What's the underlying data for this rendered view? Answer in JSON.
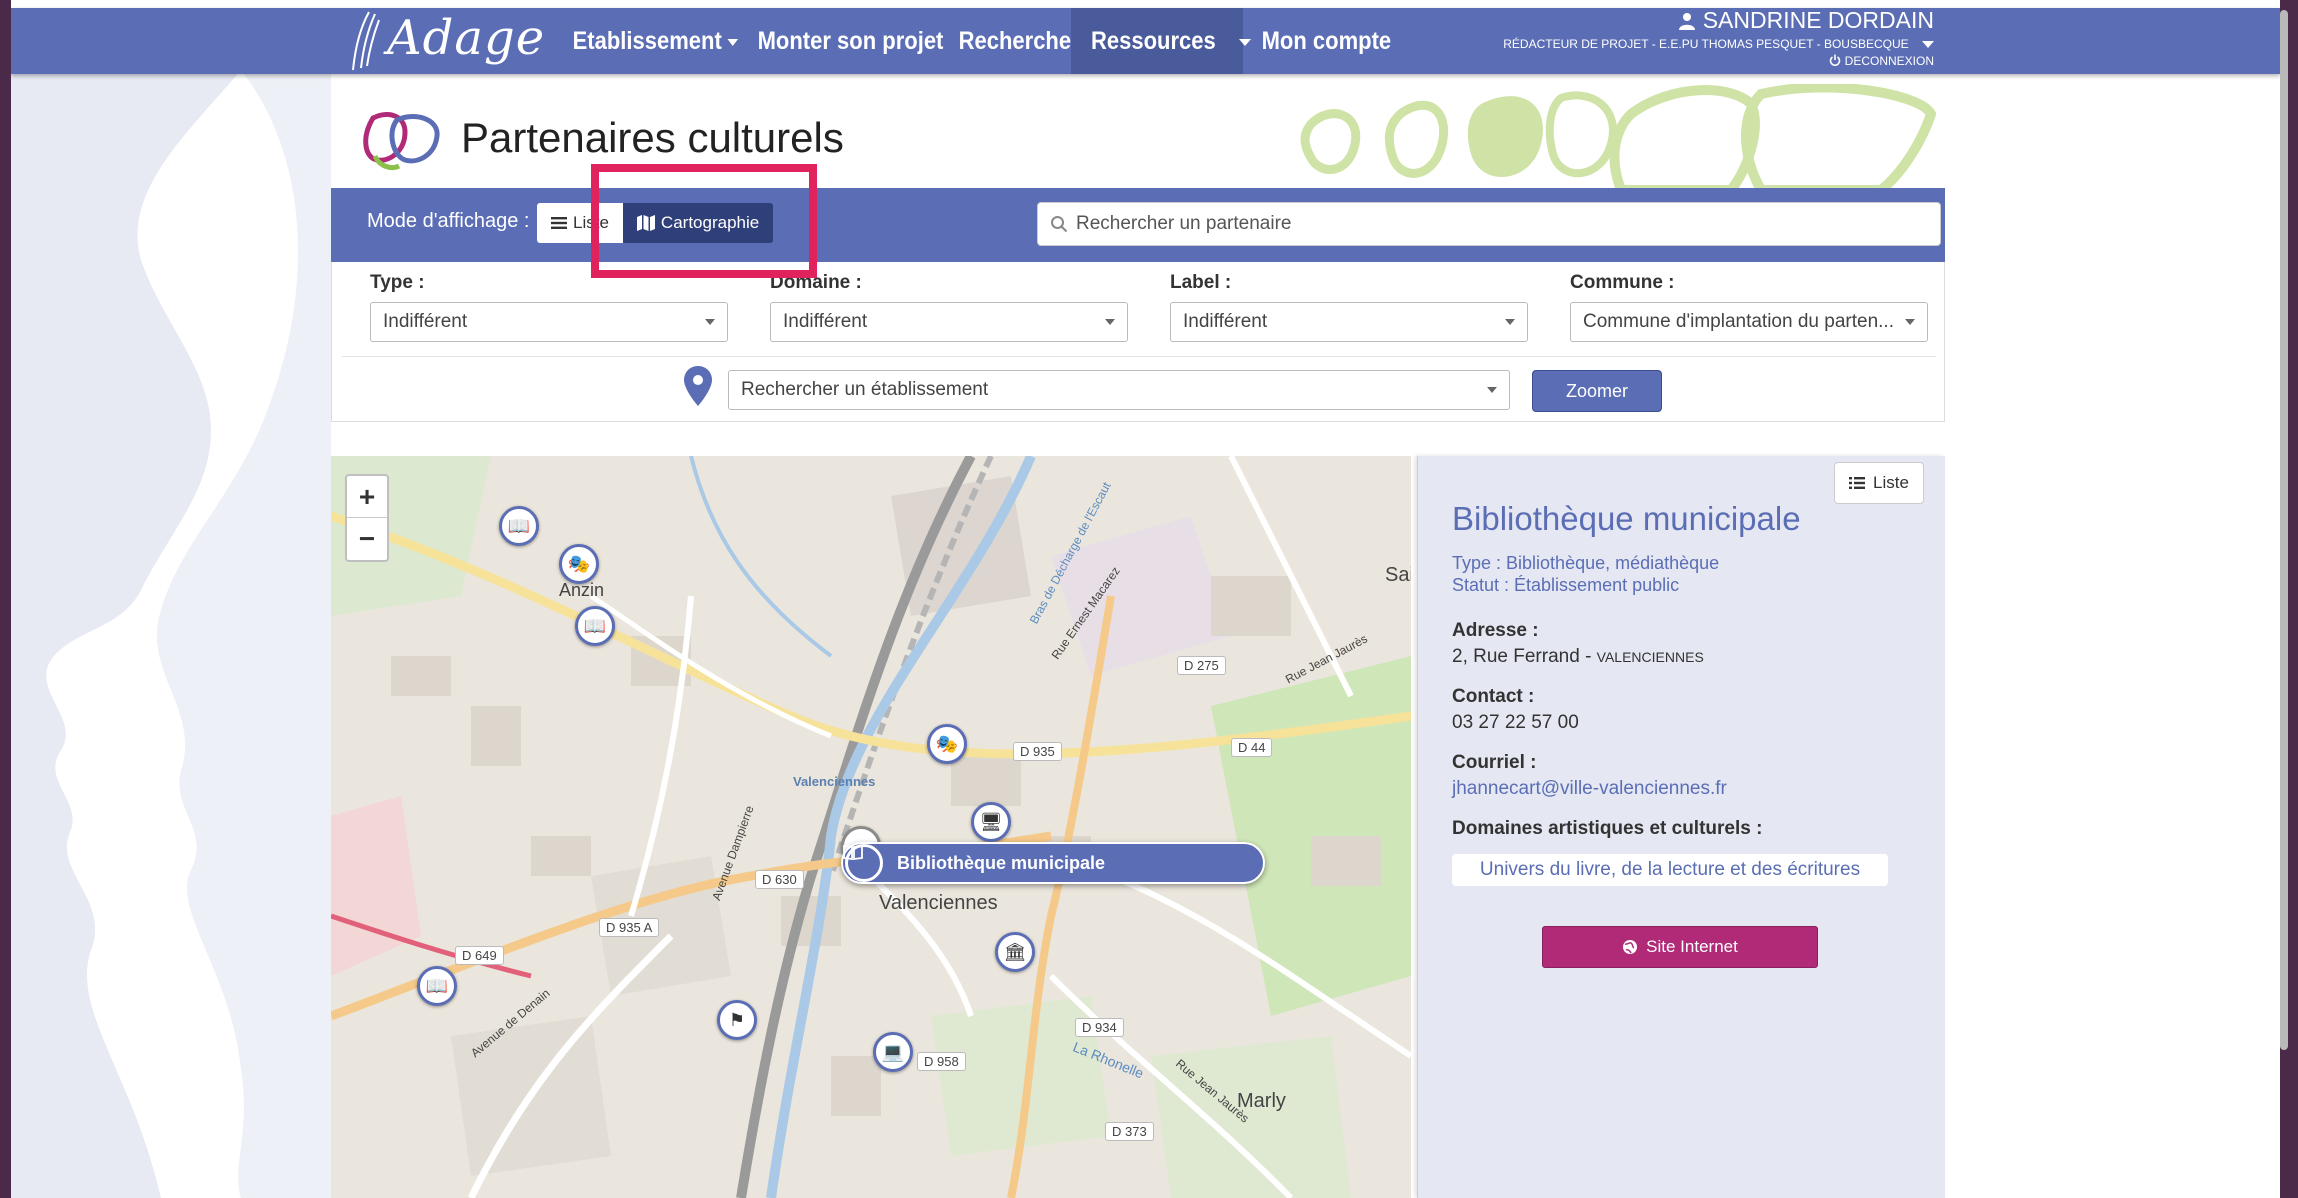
{
  "nav": {
    "logo": "Adage",
    "items": [
      {
        "label": "Etablissement",
        "has_caret": true
      },
      {
        "label": "Monter son projet",
        "has_caret": false
      },
      {
        "label": "Rechercher",
        "has_caret": false
      },
      {
        "label": "Ressources",
        "has_caret": true
      },
      {
        "label": "Mon compte",
        "has_caret": false
      }
    ],
    "user_name": "SANDRINE DORDAIN",
    "user_role": "RÉDACTEUR DE PROJET - E.E.PU THOMAS PESQUET - BOUSBECQUE",
    "logout": "DECONNEXION"
  },
  "page": {
    "title": "Partenaires culturels"
  },
  "display_mode": {
    "label": "Mode d'affichage :",
    "list_label": "Liste",
    "map_label": "Cartographie",
    "selected": "Cartographie"
  },
  "search": {
    "placeholder": "Rechercher un partenaire"
  },
  "filters": [
    {
      "label": "Type :",
      "value": "Indifférent"
    },
    {
      "label": "Domaine :",
      "value": "Indifférent"
    },
    {
      "label": "Label :",
      "value": "Indifférent"
    },
    {
      "label": "Commune :",
      "value": "Commune d'implantation du parten..."
    }
  ],
  "etablissement": {
    "placeholder": "Rechercher un établissement",
    "zoom_label": "Zoomer"
  },
  "map": {
    "zoom_in": "+",
    "zoom_out": "−",
    "places": [
      "Anzin",
      "Valenciennes",
      "Marly",
      "Sai"
    ],
    "small_place": "Valenciennes",
    "roads": [
      "D 275",
      "D 935",
      "D 44",
      "D 630",
      "D 935 A",
      "D 649",
      "D 934",
      "D 958",
      "D 373"
    ],
    "street_names": [
      "Avenue Dampierre",
      "Avenue de Denain",
      "Rue Jean Jaurès",
      "Bras de Décharge de l'Escaut",
      "Rue Ernest Macarez",
      "La Rhonelle",
      "Rue Jean Jaurès"
    ],
    "popup_label": "Bibliothèque municipale"
  },
  "panel": {
    "list_button": "Liste",
    "name": "Bibliothèque municipale",
    "type": "Type : Bibliothèque, médiathèque",
    "status": "Statut : Établissement public",
    "address_label": "Adresse :",
    "address": "2, Rue Ferrand - ",
    "city": "VALENCIENNES",
    "contact_label": "Contact :",
    "phone": "03 27 22 57 00",
    "email_label": "Courriel :",
    "email": "jhannecart@ville-valenciennes.fr",
    "domains_label": "Domaines artistiques et culturels :",
    "domain": "Univers du livre, de la lecture et des écritures",
    "website_button": "Site Internet"
  },
  "colors": {
    "primary": "#5b6eb5",
    "highlight": "#e0235c",
    "website_button": "#b02a78"
  }
}
